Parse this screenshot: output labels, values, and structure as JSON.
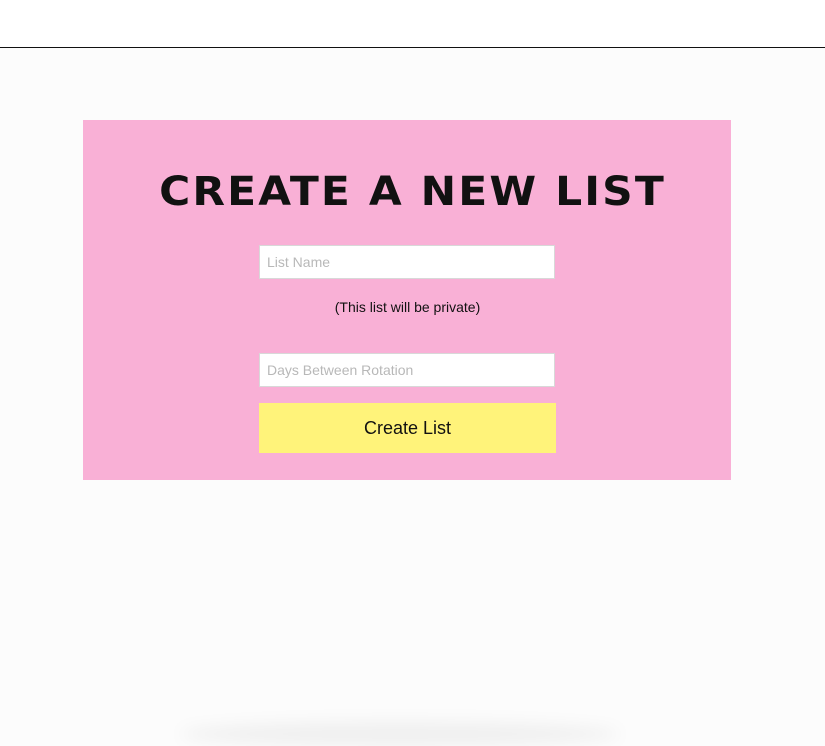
{
  "form": {
    "title": "CREATE A NEW LIST",
    "list_name_placeholder": "List Name",
    "private_note": "(This list will be private)",
    "days_placeholder": "Days Between Rotation",
    "create_button_label": "Create List"
  },
  "colors": {
    "card_background": "#f9b0d6",
    "button_background": "#fff37a",
    "page_background": "#fcfcfc"
  }
}
